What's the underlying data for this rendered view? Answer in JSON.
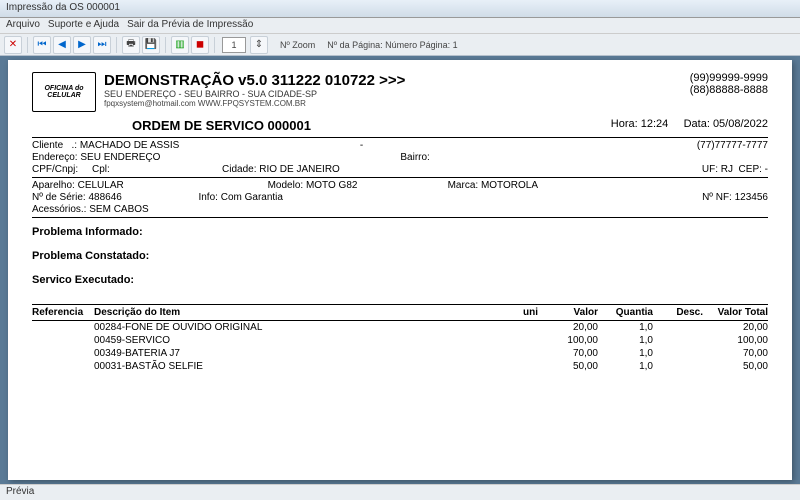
{
  "window": {
    "title": "Impressão da OS 000001"
  },
  "menu": {
    "arquivo": "Arquivo",
    "suporte": "Suporte e Ajuda",
    "sair": "Sair da Prévia de Impressão"
  },
  "toolbar": {
    "zoom_value": "1",
    "zoom_lbl": "Nº Zoom",
    "page_lbl": "Nº da Página: Número Página: 1"
  },
  "company": {
    "logo": "OFICINA do CELULAR",
    "title": "DEMONSTRAÇÃO v5.0 311222 010722 >>>",
    "addr": "SEU ENDEREÇO - SEU BAIRRO - SUA CIDADE-SP",
    "contact": "fpqxsystem@hotmail.com  WWW.FPQSYSTEM.COM.BR",
    "phone1": "(99)99999-9999",
    "phone2": "(88)88888-8888"
  },
  "os": {
    "title": "ORDEM DE SERVICO 000001",
    "hora_lbl": "Hora:",
    "hora": "12:24",
    "data_lbl": "Data:",
    "data": "05/08/2022"
  },
  "cliente": {
    "lbl": "Cliente   .:",
    "nome": "MACHADO DE ASSIS",
    "dash": "-",
    "fone": "(77)77777-7777",
    "end_lbl": "Endereço:",
    "end": "SEU ENDEREÇO",
    "bairro_lbl": "Bairro:",
    "cpf_lbl": "CPF/Cnpj:",
    "cpl_lbl": "Cpl:",
    "cidade_lbl": "Cidade:",
    "cidade": "RIO DE JANEIRO",
    "uf_lbl": "UF:",
    "uf": "RJ",
    "cep_lbl": "CEP:",
    "cep": "   -"
  },
  "aparelho": {
    "lbl": "Aparelho:",
    "val": "CELULAR",
    "modelo_lbl": "Modelo:",
    "modelo": "MOTO G82",
    "marca_lbl": "Marca:",
    "marca": "MOTOROLA",
    "serie_lbl": "Nº de Série:",
    "serie": "488646",
    "info_lbl": "Info:",
    "info": "Com Garantia",
    "nf_lbl": "Nº NF:",
    "nf": "123456",
    "acess_lbl": "Acessórios.:",
    "acess": "SEM CABOS"
  },
  "secoes": {
    "p1": "Problema Informado:",
    "p2": "Problema Constatado:",
    "p3": "Servico Executado:"
  },
  "tbl": {
    "h": {
      "ref": "Referencia",
      "desc": "Descrição do Item",
      "uni": "uni",
      "valor": "Valor",
      "quant": "Quantia",
      "desc2": "Desc.",
      "total": "Valor Total"
    },
    "rows": [
      {
        "ref": "",
        "desc": "00284-FONE DE OUVIDO ORIGINAL",
        "uni": "",
        "valor": "20,00",
        "quant": "1,0",
        "desc2": "",
        "total": "20,00"
      },
      {
        "ref": "",
        "desc": "00459-SERVICO",
        "uni": "",
        "valor": "100,00",
        "quant": "1,0",
        "desc2": "",
        "total": "100,00"
      },
      {
        "ref": "",
        "desc": "00349-BATERIA J7",
        "uni": "",
        "valor": "70,00",
        "quant": "1,0",
        "desc2": "",
        "total": "70,00"
      },
      {
        "ref": "",
        "desc": "00031-BASTÃO SELFIE",
        "uni": "",
        "valor": "50,00",
        "quant": "1,0",
        "desc2": "",
        "total": "50,00"
      }
    ]
  },
  "status": "Prévia"
}
